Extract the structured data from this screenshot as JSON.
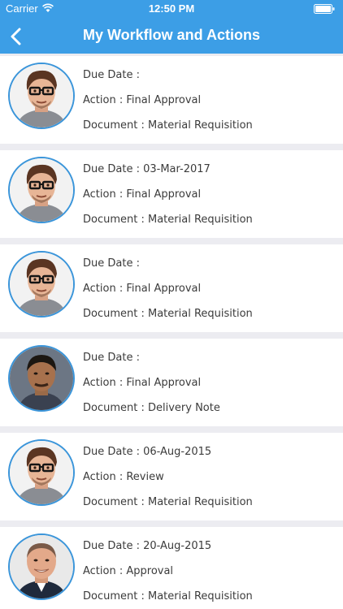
{
  "status_bar": {
    "carrier": "Carrier",
    "time": "12:50 PM"
  },
  "header": {
    "title": "My Workflow and Actions",
    "background": "#3c9ee6"
  },
  "workflow_items": [
    {
      "due_date": "Due Date :",
      "action": "Action : Final Approval",
      "document": "Document : Material Requisition",
      "avatar": "glasses-man"
    },
    {
      "due_date": "Due Date : 03-Mar-2017",
      "action": "Action : Final Approval",
      "document": "Document : Material Requisition",
      "avatar": "glasses-man"
    },
    {
      "due_date": "Due Date :",
      "action": "Action : Final Approval",
      "document": "Document : Material Requisition",
      "avatar": "glasses-man"
    },
    {
      "due_date": "Due Date :",
      "action": "Action : Final Approval",
      "document": "Document : Delivery Note",
      "avatar": "dark-haired-man"
    },
    {
      "due_date": "Due Date : 06-Aug-2015",
      "action": "Action : Review",
      "document": "Document : Material Requisition",
      "avatar": "glasses-man"
    },
    {
      "due_date": "Due Date : 20-Aug-2015",
      "action": "Action : Approval",
      "document": "Document : Material Requisition",
      "avatar": "bald-man"
    }
  ]
}
